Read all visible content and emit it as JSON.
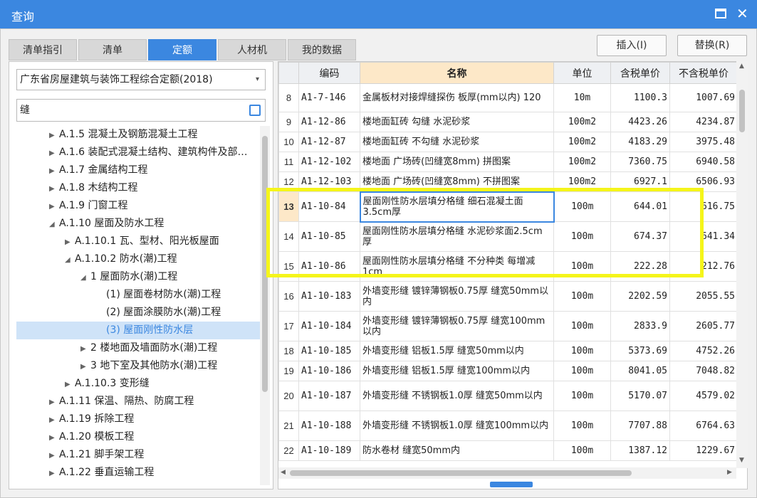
{
  "window": {
    "title": "查询"
  },
  "tabs": [
    "清单指引",
    "清单",
    "定额",
    "人材机",
    "我的数据"
  ],
  "buttons": {
    "insert": "插入(I)",
    "replace": "替换(R)"
  },
  "library": {
    "selected": "广东省房屋建筑与装饰工程综合定额(2018)"
  },
  "search": {
    "value": "缝"
  },
  "tree": [
    {
      "label": "A.1.5 混凝土及钢筋混凝土工程",
      "level": 1,
      "toggle": "▶"
    },
    {
      "label": "A.1.6 装配式混凝土结构、建筑构件及部…",
      "level": 1,
      "toggle": "▶"
    },
    {
      "label": "A.1.7 金属结构工程",
      "level": 1,
      "toggle": "▶"
    },
    {
      "label": "A.1.8 木结构工程",
      "level": 1,
      "toggle": "▶"
    },
    {
      "label": "A.1.9 门窗工程",
      "level": 1,
      "toggle": "▶"
    },
    {
      "label": "A.1.10 屋面及防水工程",
      "level": 1,
      "toggle": "◢"
    },
    {
      "label": "A.1.10.1 瓦、型材、阳光板屋面",
      "level": 2,
      "toggle": "▶"
    },
    {
      "label": "A.1.10.2 防水(潮)工程",
      "level": 2,
      "toggle": "◢"
    },
    {
      "label": "1 屋面防水(潮)工程",
      "level": 3,
      "toggle": "◢"
    },
    {
      "label": "(1) 屋面卷材防水(潮)工程",
      "level": 4,
      "toggle": ""
    },
    {
      "label": "(2) 屋面涂膜防水(潮)工程",
      "level": 4,
      "toggle": ""
    },
    {
      "label": "(3) 屋面刚性防水层",
      "level": 4,
      "toggle": "",
      "selected": true
    },
    {
      "label": "2 楼地面及墙面防水(潮)工程",
      "level": 3,
      "toggle": "▶"
    },
    {
      "label": "3 地下室及其他防水(潮)工程",
      "level": 3,
      "toggle": "▶"
    },
    {
      "label": "A.1.10.3 变形缝",
      "level": 2,
      "toggle": "▶"
    },
    {
      "label": "A.1.11 保温、隔热、防腐工程",
      "level": 1,
      "toggle": "▶"
    },
    {
      "label": "A.1.19 拆除工程",
      "level": 1,
      "toggle": "▶"
    },
    {
      "label": "A.1.20 模板工程",
      "level": 1,
      "toggle": "▶"
    },
    {
      "label": "A.1.21 脚手架工程",
      "level": 1,
      "toggle": "▶"
    },
    {
      "label": "A.1.22 垂直运输工程",
      "level": 1,
      "toggle": "▶"
    }
  ],
  "table": {
    "headers": [
      "",
      "编码",
      "名称",
      "单位",
      "含税单价",
      "不含税单价"
    ],
    "rows": [
      {
        "n": "8",
        "code": "A1-7-146",
        "name": "金属板材对接焊缝探伤 板厚(mm以内) 120",
        "unit": "10m",
        "tax": "1100.3",
        "notax": "1007.69"
      },
      {
        "n": "9",
        "code": "A1-12-86",
        "name": "楼地面缸砖 勾缝 水泥砂浆",
        "unit": "100m2",
        "tax": "4423.26",
        "notax": "4234.87"
      },
      {
        "n": "10",
        "code": "A1-12-87",
        "name": "楼地面缸砖 不勾缝 水泥砂浆",
        "unit": "100m2",
        "tax": "4183.29",
        "notax": "3975.48"
      },
      {
        "n": "11",
        "code": "A1-12-102",
        "name": "楼地面 广场砖(凹缝宽8mm) 拼图案",
        "unit": "100m2",
        "tax": "7360.75",
        "notax": "6940.58"
      },
      {
        "n": "12",
        "code": "A1-12-103",
        "name": "楼地面 广场砖(凹缝宽8mm) 不拼图案",
        "unit": "100m2",
        "tax": "6927.1",
        "notax": "6506.93"
      },
      {
        "n": "13",
        "code": "A1-10-84",
        "name": "屋面刚性防水层填分格缝 细石混凝土面3.5cm厚",
        "unit": "100m",
        "tax": "644.01",
        "notax": "616.75",
        "current": true
      },
      {
        "n": "14",
        "code": "A1-10-85",
        "name": "屋面刚性防水层填分格缝 水泥砂浆面2.5cm厚",
        "unit": "100m",
        "tax": "674.37",
        "notax": "641.34"
      },
      {
        "n": "15",
        "code": "A1-10-86",
        "name": "屋面刚性防水层填分格缝 不分种类 每增减1cm",
        "unit": "100m",
        "tax": "222.28",
        "notax": "212.76"
      },
      {
        "n": "16",
        "code": "A1-10-183",
        "name": "外墙变形缝 镀锌薄钢板0.75厚 缝宽50mm以内",
        "unit": "100m",
        "tax": "2202.59",
        "notax": "2055.55"
      },
      {
        "n": "17",
        "code": "A1-10-184",
        "name": "外墙变形缝 镀锌薄钢板0.75厚 缝宽100mm以内",
        "unit": "100m",
        "tax": "2833.9",
        "notax": "2605.77"
      },
      {
        "n": "18",
        "code": "A1-10-185",
        "name": "外墙变形缝 铝板1.5厚 缝宽50mm以内",
        "unit": "100m",
        "tax": "5373.69",
        "notax": "4752.26"
      },
      {
        "n": "19",
        "code": "A1-10-186",
        "name": "外墙变形缝 铝板1.5厚 缝宽100mm以内",
        "unit": "100m",
        "tax": "8041.05",
        "notax": "7048.82"
      },
      {
        "n": "20",
        "code": "A1-10-187",
        "name": "外墙变形缝 不锈钢板1.0厚 缝宽50mm以内",
        "unit": "100m",
        "tax": "5170.07",
        "notax": "4579.02"
      },
      {
        "n": "21",
        "code": "A1-10-188",
        "name": "外墙变形缝 不锈钢板1.0厚 缝宽100mm以内",
        "unit": "100m",
        "tax": "7707.88",
        "notax": "6764.63"
      },
      {
        "n": "22",
        "code": "A1-10-189",
        "name": "防水卷材 缝宽50mm内",
        "unit": "100m",
        "tax": "1387.12",
        "notax": "1229.67"
      }
    ]
  }
}
